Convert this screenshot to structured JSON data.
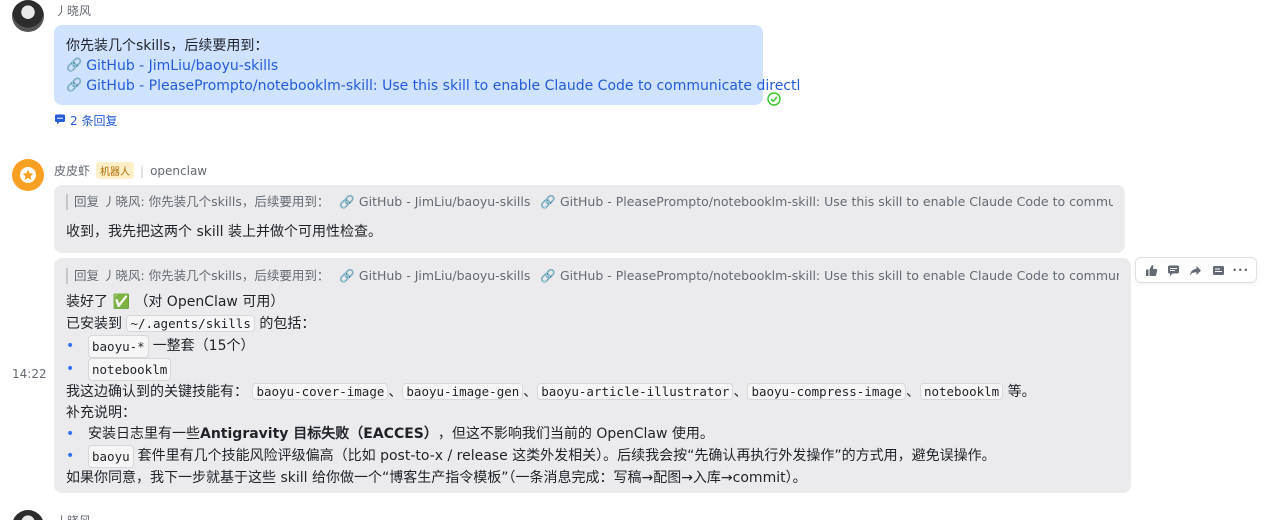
{
  "message1": {
    "author": "丿晓风",
    "text": "你先装几个skills，后续要用到：",
    "links": [
      "GitHub - JimLiu/baoyu-skills",
      "GitHub - PleasePrompto/notebooklm-skill: Use this skill to enable Claude Code to communicate directl"
    ],
    "status_icon": "check-circle-icon",
    "reply_count": "2 条回复"
  },
  "bot": {
    "name": "皮皮虾",
    "tag": "机器人",
    "source": "openclaw",
    "timestamp": "14:22"
  },
  "reply1": {
    "quote_prefix": "回复 丿晓风: 你先装几个skills，后续要用到：",
    "quote_links": [
      "GitHub - JimLiu/baoyu-skills",
      "GitHub - PleasePrompto/notebooklm-skill: Use this skill to enable Claude Code to communicate directl"
    ],
    "text": "收到，我先把这两个 skill 装上并做个可用性检查。"
  },
  "reply2": {
    "quote_prefix": "回复 丿晓风: 你先装几个skills，后续要用到：",
    "quote_links": [
      "GitHub - JimLiu/baoyu-skills",
      "GitHub - PleasePrompto/notebooklm-skill: Use this skill to enable Claude Code to communicate directl"
    ],
    "line1_a": "装好了",
    "line1_emoji": "✅",
    "line1_b": "（对 OpenClaw 可用）",
    "line2_a": "已安装到",
    "line2_code": "~/.agents/skills",
    "line2_b": "的包括：",
    "bullet1_code": "baoyu-*",
    "bullet1_text": "一整套（15个）",
    "bullet2_code": "notebooklm",
    "line3_a": "我这边确认到的关键技能有：",
    "line3_codes": [
      "baoyu-cover-image",
      "baoyu-image-gen",
      "baoyu-article-illustrator",
      "baoyu-compress-image",
      "notebooklm"
    ],
    "line3_sep": "、",
    "line3_b": "等。",
    "line4": "补充说明：",
    "bullet3_a": "安装日志里有一些",
    "bullet3_bold": "Antigravity 目标失败（EACCES）",
    "bullet3_b": "，但这不影响我们当前的 OpenClaw 使用。",
    "bullet4_code": "baoyu",
    "bullet4_text": "套件里有几个技能风险评级偏高（比如 post-to-x / release 这类外发相关）。后续我会按“先确认再执行外发操作”的方式用，避免误操作。",
    "line5": "如果你同意，我下一步就基于这些 skill 给你做一个“博客生产指令模板”（一条消息完成：写稿→配图→入库→commit）。"
  },
  "toolbar": {
    "icons": [
      "thumbs-up-icon",
      "comment-icon",
      "forward-icon",
      "pin-icon",
      "more-icon"
    ]
  },
  "message3": {
    "author": "丿晓风"
  }
}
